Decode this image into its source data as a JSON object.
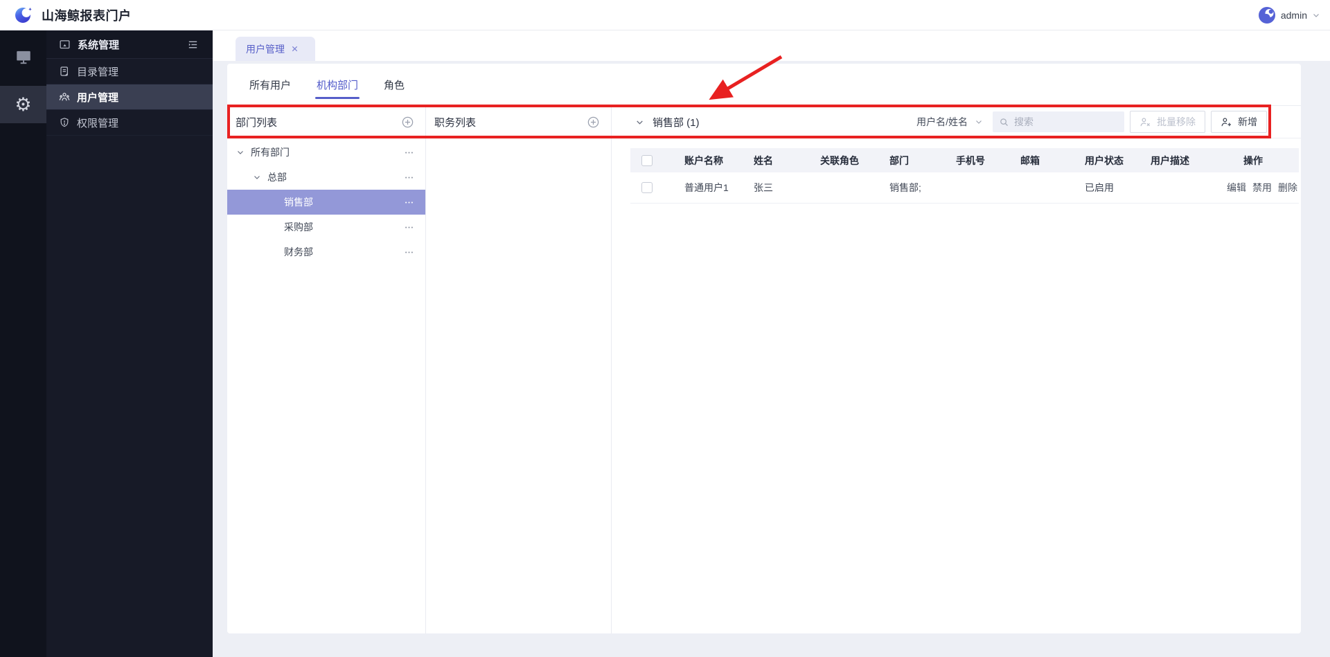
{
  "topbar": {
    "title": "山海鲸报表门户",
    "username": "admin"
  },
  "sidebar": {
    "section": "系统管理",
    "items": [
      {
        "label": "目录管理"
      },
      {
        "label": "用户管理"
      },
      {
        "label": "权限管理"
      }
    ]
  },
  "tabstrip": {
    "active_tab": "用户管理"
  },
  "tabs": {
    "all_users": "所有用户",
    "org_dept": "机构部门",
    "role": "角色"
  },
  "dept_panel": {
    "title": "部门列表",
    "tree": [
      {
        "label": "所有部门"
      },
      {
        "label": "总部"
      },
      {
        "label": "销售部"
      },
      {
        "label": "采购部"
      },
      {
        "label": "财务部"
      }
    ]
  },
  "pos_panel": {
    "title": "职务列表"
  },
  "users_panel": {
    "group_label": "销售部 (1)",
    "filter_label": "用户名/姓名",
    "search_placeholder": "搜索",
    "batch_remove_label": "批量移除",
    "add_label": "新增",
    "headers": [
      "账户名称",
      "姓名",
      "关联角色",
      "部门",
      "手机号",
      "邮箱",
      "用户状态",
      "用户描述",
      "操作"
    ],
    "row": {
      "account": "普通用户1",
      "name": "张三",
      "roles": "",
      "dept": "销售部;",
      "phone": "",
      "email": "",
      "status": "已启用",
      "desc": ""
    },
    "actions": {
      "edit": "编辑",
      "disable": "禁用",
      "delete": "删除"
    }
  },
  "colors": {
    "accent": "#5059c9",
    "tree_selected_bg": "#9398d8",
    "annotation_red": "#e82121",
    "sidebar_bg": "#171a27",
    "rail_bg": "#10131d"
  }
}
